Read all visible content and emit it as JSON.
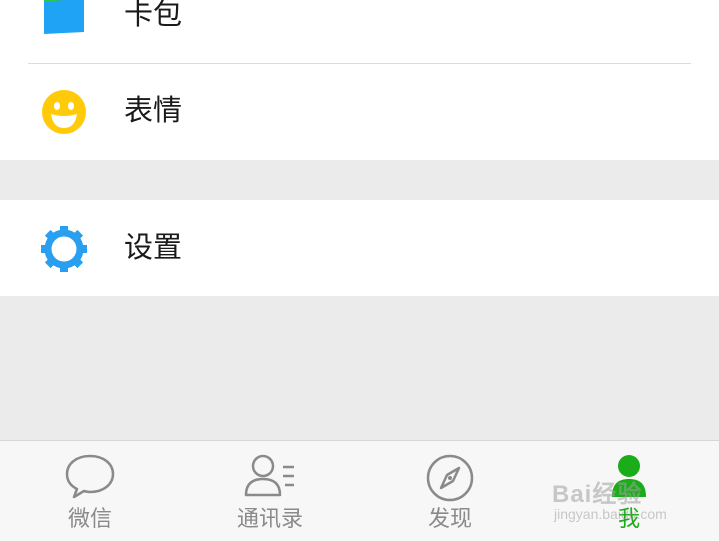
{
  "menu": {
    "wallet_label": "卡包",
    "sticker_label": "表情",
    "settings_label": "设置"
  },
  "tabbar": {
    "chats_label": "微信",
    "contacts_label": "通讯录",
    "discover_label": "发现",
    "me_label": "我"
  },
  "watermark": {
    "main": "Bai经验",
    "url": "jingyan.baidu.com"
  },
  "colors": {
    "accent_green": "#1aad19",
    "settings_blue": "#2a9ff0",
    "sticker_yellow": "#ffca0a",
    "wallet_blue": "#1fa3f5",
    "wallet_green": "#2fc44d"
  }
}
